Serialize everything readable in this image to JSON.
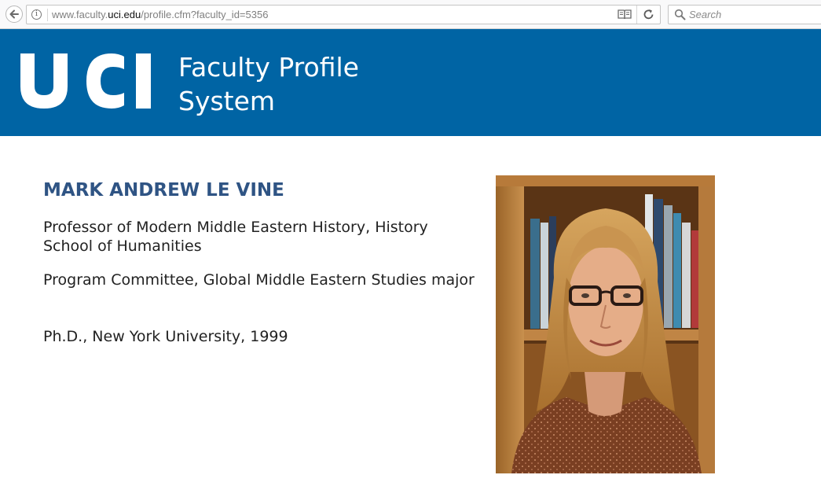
{
  "browser": {
    "url_prefix": "www.faculty.",
    "url_domain": "uci.edu",
    "url_suffix": "/profile.cfm?faculty_id=5356",
    "search_placeholder": "Search"
  },
  "banner": {
    "logo_text": "UCI",
    "title_line1": "Faculty Profile",
    "title_line2": "System",
    "background_color": "#0064a4"
  },
  "profile": {
    "name": "MARK ANDREW LE VINE",
    "title": "Professor of Modern Middle Eastern History, History",
    "school": "School of Humanities",
    "program": "Program Committee, Global Middle Eastern Studies major",
    "degree": "Ph.D., New York University, 1999",
    "name_color": "#2f5484"
  },
  "icons": {
    "back": "back-arrow-icon",
    "info": "info-icon",
    "reader": "reader-view-icon",
    "reload": "reload-icon",
    "search": "search-icon"
  }
}
